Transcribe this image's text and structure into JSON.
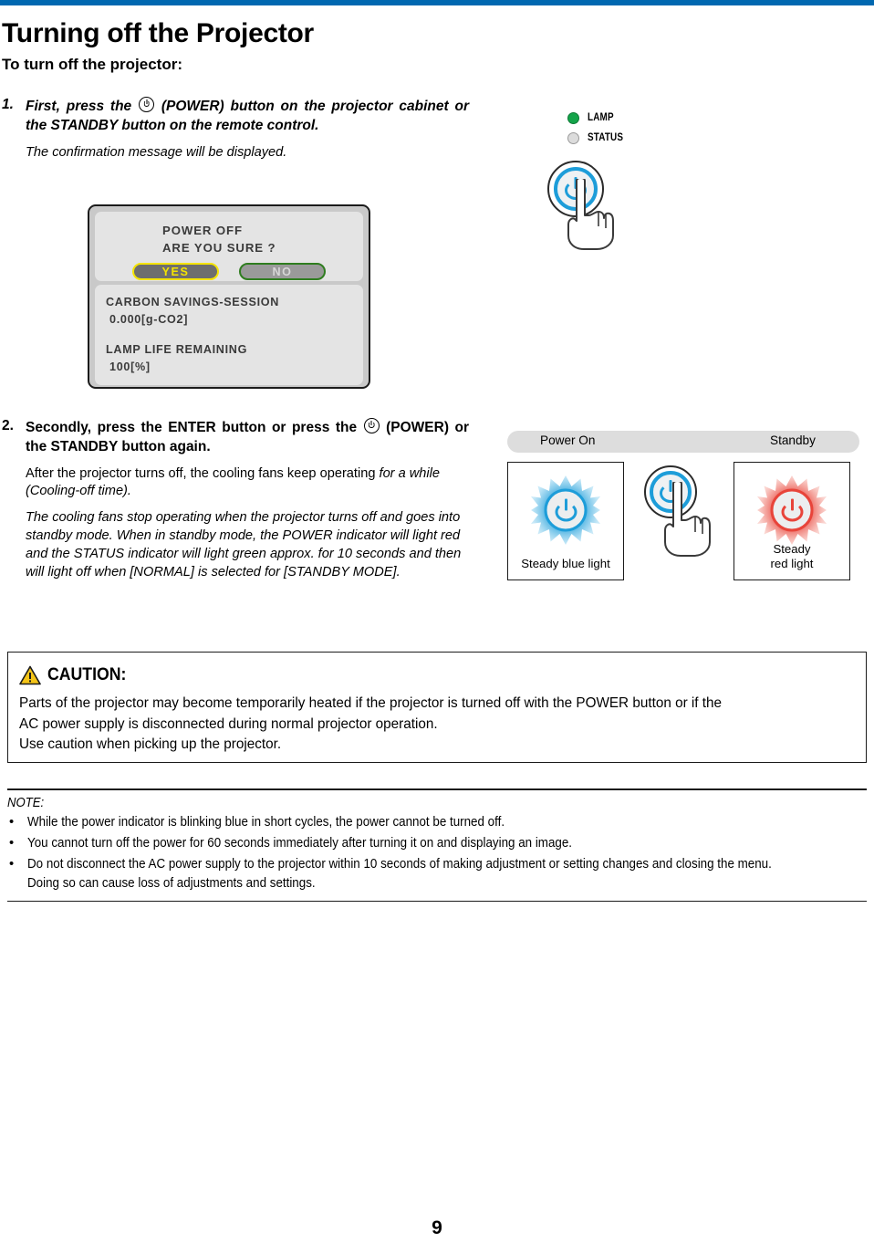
{
  "document": {
    "title": "Turning off the Projector",
    "subtitle": "To turn off the projector:",
    "page_number": "9",
    "accent_color": "#0068b0"
  },
  "steps": [
    {
      "number": "1.",
      "lead_a": "First, press the",
      "lead_b": "(POWER) button on the projector cabinet or the STANDBY button on the remote control.",
      "note": "The confirmation message will be displayed."
    },
    {
      "number": "2.",
      "lead_a": "Secondly, press the ENTER button or press the",
      "lead_b": "(POWER) or the STANDBY button again.",
      "para1_plain": "After the projector turns off, the cooling fans keep operating ",
      "para1_italic": "for a while (Cooling-off time).",
      "para2": "The cooling fans stop operating when the projector turns off and goes into standby mode. When in standby mode, the POWER indicator will light red and the STATUS indicator will light green approx. for 10 seconds and then will light off when [NORMAL] is selected for [STANDBY MODE]."
    }
  ],
  "osd": {
    "line1": "POWER OFF",
    "line2": "ARE YOU SURE ?",
    "yes_label": "YES",
    "no_label": "NO",
    "carbon_label": "CARBON SAVINGS-SESSION",
    "carbon_value": "0.000[g-CO2]",
    "lamp_label": "LAMP LIFE REMAINING",
    "lamp_value": "100[%]",
    "yes_border_color": "#f5e400",
    "no_border_color": "#2f7d1f"
  },
  "cabinet": {
    "indicators": [
      {
        "label": "LAMP",
        "state": "green"
      },
      {
        "label": "STATUS",
        "state": "off"
      }
    ],
    "lamp_color": "#14a44a",
    "status_color": "#dcdcdc",
    "button_color": "#1d9dd9"
  },
  "diagram": {
    "bar_left_label": "Power On",
    "bar_right_label": "Standby",
    "left_caption": "Steady blue light",
    "right_caption_line1": "Steady",
    "right_caption_line2": "red light",
    "blue": "#1d9dd9",
    "red": "#e8443a"
  },
  "caution": {
    "title": "CAUTION:",
    "line1": "Parts of the projector may become temporarily heated if the projector is turned off with the POWER button or if the",
    "line2": "AC power supply is disconnected during normal projector operation.",
    "line3": "Use caution when picking up the projector.",
    "icon_color": "#f5c518"
  },
  "note": {
    "title": "NOTE:",
    "bullet": "•",
    "items": [
      "While the power indicator is blinking blue in short cycles, the power cannot be turned off.",
      "You cannot turn off the power for 60 seconds immediately after turning it on and displaying an image.",
      "Do not disconnect the AC power supply to the projector within 10 seconds of making adjustment or setting changes and closing the menu. Doing so can cause loss of adjustments and settings."
    ]
  }
}
